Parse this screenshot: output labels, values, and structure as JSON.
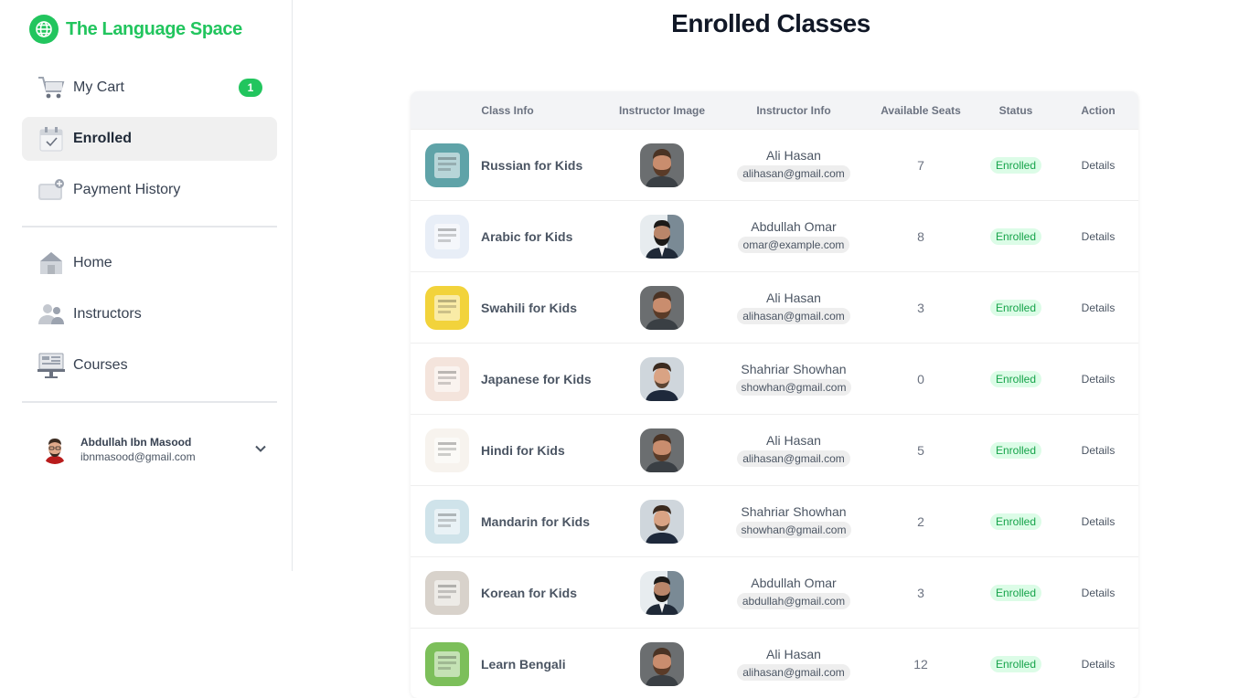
{
  "brand": {
    "name": "The Language Space",
    "logo_icon": "globe-icon",
    "color": "#22c55e"
  },
  "sidebar": {
    "items": [
      {
        "label": "My Cart",
        "icon": "cart-icon",
        "badge": "1"
      },
      {
        "label": "Enrolled",
        "icon": "calendar-check-icon",
        "active": true
      },
      {
        "label": "Payment History",
        "icon": "wallet-icon"
      },
      {
        "label": "Home",
        "icon": "home-icon"
      },
      {
        "label": "Instructors",
        "icon": "users-icon"
      },
      {
        "label": "Courses",
        "icon": "classroom-icon"
      }
    ]
  },
  "user": {
    "name": "Abdullah Ibn Masood",
    "email": "ibnmasood@gmail.com"
  },
  "page": {
    "title": "Enrolled Classes"
  },
  "table": {
    "headers": [
      "Class Info",
      "Instructor Image",
      "Instructor Info",
      "Available Seats",
      "Status",
      "Action"
    ],
    "rows": [
      {
        "class_name": "Russian for Kids",
        "instructor": "Ali Hasan",
        "email": "alihasan@gmail.com",
        "seats": "7",
        "status": "Enrolled",
        "action": "Details",
        "thumb_color": "#5fa3a8",
        "inst": "ali"
      },
      {
        "class_name": "Arabic for Kids",
        "instructor": "Abdullah Omar",
        "email": "omar@example.com",
        "seats": "8",
        "status": "Enrolled",
        "action": "Details",
        "thumb_color": "#e8eef7",
        "inst": "omar"
      },
      {
        "class_name": "Swahili for Kids",
        "instructor": "Ali Hasan",
        "email": "alihasan@gmail.com",
        "seats": "3",
        "status": "Enrolled",
        "action": "Details",
        "thumb_color": "#f2d33b",
        "inst": "ali"
      },
      {
        "class_name": "Japanese for Kids",
        "instructor": "Shahriar Showhan",
        "email": "showhan@gmail.com",
        "seats": "0",
        "status": "Enrolled",
        "action": "Details",
        "thumb_color": "#f4e4dc",
        "inst": "showhan"
      },
      {
        "class_name": "Hindi for Kids",
        "instructor": "Ali Hasan",
        "email": "alihasan@gmail.com",
        "seats": "5",
        "status": "Enrolled",
        "action": "Details",
        "thumb_color": "#f7f3ee",
        "inst": "ali"
      },
      {
        "class_name": "Mandarin for Kids",
        "instructor": "Shahriar Showhan",
        "email": "showhan@gmail.com",
        "seats": "2",
        "status": "Enrolled",
        "action": "Details",
        "thumb_color": "#cfe3ea",
        "inst": "showhan"
      },
      {
        "class_name": "Korean for Kids",
        "instructor": "Abdullah Omar",
        "email": "abdullah@gmail.com",
        "seats": "3",
        "status": "Enrolled",
        "action": "Details",
        "thumb_color": "#d8d2cb",
        "inst": "omar"
      },
      {
        "class_name": "Learn Bengali",
        "instructor": "Ali Hasan",
        "email": "alihasan@gmail.com",
        "seats": "12",
        "status": "Enrolled",
        "action": "Details",
        "thumb_color": "#7cbf5a",
        "inst": "ali"
      }
    ]
  }
}
